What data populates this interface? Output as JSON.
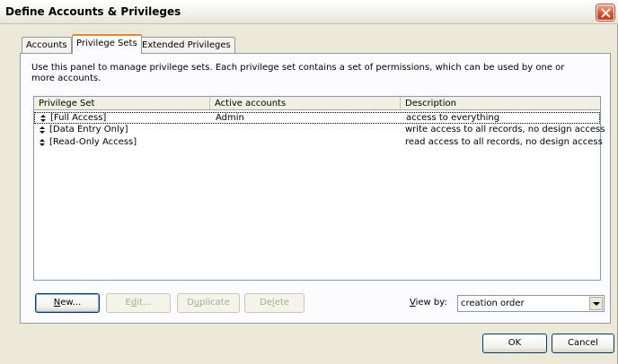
{
  "window": {
    "title": "Define Accounts & Privileges"
  },
  "tabs": [
    {
      "label": "Accounts"
    },
    {
      "label": "Privilege Sets"
    },
    {
      "label": "Extended Privileges"
    }
  ],
  "panel": {
    "instructions": "Use this panel to manage privilege sets.  Each privilege set contains a set of permissions, which can be used by one or more accounts.",
    "columns": [
      "Privilege Set",
      "Active accounts",
      "Description"
    ],
    "rows": [
      {
        "name": "[Full Access]",
        "accounts": "Admin",
        "description": "access to everything"
      },
      {
        "name": "[Data Entry Only]",
        "accounts": "",
        "description": "write access to all records, no design access"
      },
      {
        "name": "[Read-Only Access]",
        "accounts": "",
        "description": "read access to all records, no design access"
      }
    ],
    "buttons": {
      "new": {
        "pre": "",
        "key": "N",
        "post": "ew..."
      },
      "edit": {
        "pre": "E",
        "key": "d",
        "post": "it..."
      },
      "duplicate": {
        "pre": "D",
        "key": "u",
        "post": "plicate"
      },
      "delete": {
        "pre": "De",
        "key": "l",
        "post": "ete"
      }
    },
    "view_by": {
      "key": "V",
      "post": "iew by:",
      "value": "creation order"
    }
  },
  "footer": {
    "ok_label": "OK",
    "cancel_label": "Cancel"
  }
}
